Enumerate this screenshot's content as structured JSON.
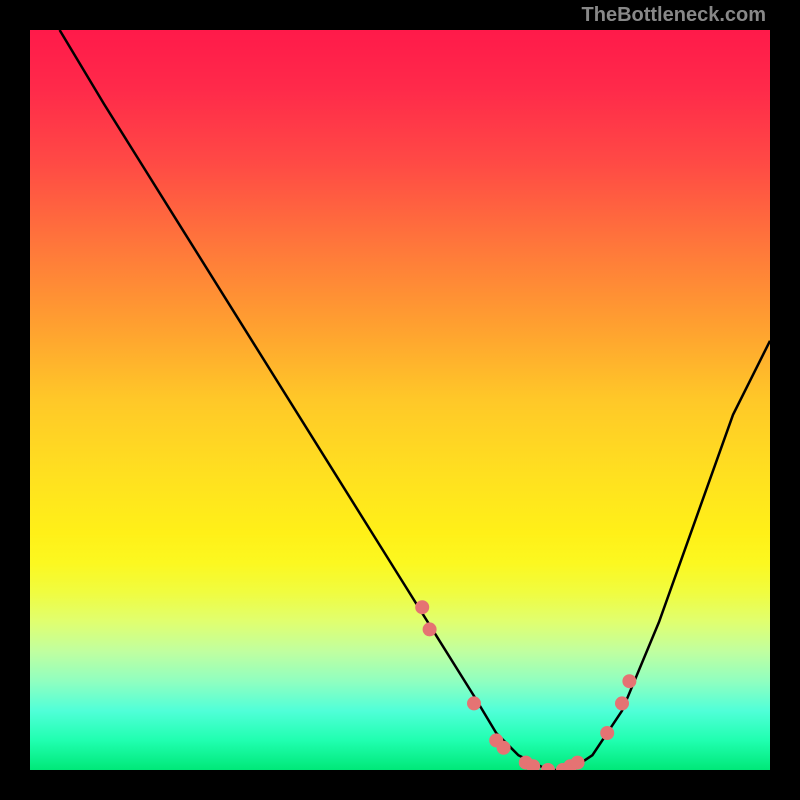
{
  "watermark": "TheBottleneck.com",
  "chart_data": {
    "type": "line",
    "title": "",
    "xlabel": "",
    "ylabel": "",
    "xlim": [
      0,
      100
    ],
    "ylim": [
      0,
      100
    ],
    "background_gradient": {
      "top": "#ff1a4a",
      "middle": "#ffe020",
      "bottom": "#00e878"
    },
    "series": [
      {
        "name": "bottleneck-curve",
        "color": "#000000",
        "x": [
          4,
          10,
          20,
          30,
          40,
          50,
          55,
          60,
          63,
          66,
          70,
          73,
          76,
          80,
          85,
          90,
          95,
          100
        ],
        "y": [
          100,
          90,
          74,
          58,
          42,
          26,
          18,
          10,
          5,
          2,
          0,
          0,
          2,
          8,
          20,
          34,
          48,
          58
        ]
      }
    ],
    "markers": {
      "name": "highlight-points",
      "color": "#e57373",
      "radius": 7,
      "x": [
        53,
        54,
        60,
        63,
        64,
        67,
        68,
        70,
        72,
        73,
        74,
        78,
        80,
        81
      ],
      "y": [
        22,
        19,
        9,
        4,
        3,
        1,
        0.5,
        0,
        0,
        0.5,
        1,
        5,
        9,
        12
      ]
    }
  }
}
